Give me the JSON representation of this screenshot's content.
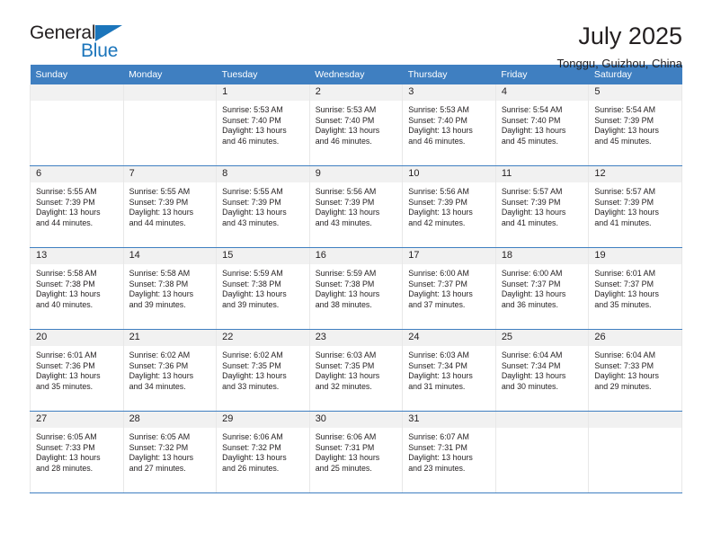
{
  "brand": {
    "name_part1": "General",
    "name_part2": "Blue",
    "triangle_icon": "blue-triangle-icon",
    "colors": {
      "dark": "#231f20",
      "blue": "#1b75bb"
    }
  },
  "header": {
    "title": "July 2025",
    "subtitle": "Tonggu, Guizhou, China"
  },
  "theme": {
    "header_row_bg": "#3f7fc1",
    "day_number_bg": "#f1f1f1",
    "cell_bg": "#ffffff",
    "separator": "#3f7fc1",
    "text": "#231f20"
  },
  "weekday_headers": [
    "Sunday",
    "Monday",
    "Tuesday",
    "Wednesday",
    "Thursday",
    "Friday",
    "Saturday"
  ],
  "weeks": [
    [
      {
        "day": "",
        "empty": true,
        "sunrise": "",
        "sunset": "",
        "daylight_line1": "",
        "daylight_line2": ""
      },
      {
        "day": "",
        "empty": true,
        "sunrise": "",
        "sunset": "",
        "daylight_line1": "",
        "daylight_line2": ""
      },
      {
        "day": "1",
        "empty": false,
        "sunrise": "Sunrise: 5:53 AM",
        "sunset": "Sunset: 7:40 PM",
        "daylight_line1": "Daylight: 13 hours",
        "daylight_line2": "and 46 minutes."
      },
      {
        "day": "2",
        "empty": false,
        "sunrise": "Sunrise: 5:53 AM",
        "sunset": "Sunset: 7:40 PM",
        "daylight_line1": "Daylight: 13 hours",
        "daylight_line2": "and 46 minutes."
      },
      {
        "day": "3",
        "empty": false,
        "sunrise": "Sunrise: 5:53 AM",
        "sunset": "Sunset: 7:40 PM",
        "daylight_line1": "Daylight: 13 hours",
        "daylight_line2": "and 46 minutes."
      },
      {
        "day": "4",
        "empty": false,
        "sunrise": "Sunrise: 5:54 AM",
        "sunset": "Sunset: 7:40 PM",
        "daylight_line1": "Daylight: 13 hours",
        "daylight_line2": "and 45 minutes."
      },
      {
        "day": "5",
        "empty": false,
        "sunrise": "Sunrise: 5:54 AM",
        "sunset": "Sunset: 7:39 PM",
        "daylight_line1": "Daylight: 13 hours",
        "daylight_line2": "and 45 minutes."
      }
    ],
    [
      {
        "day": "6",
        "empty": false,
        "sunrise": "Sunrise: 5:55 AM",
        "sunset": "Sunset: 7:39 PM",
        "daylight_line1": "Daylight: 13 hours",
        "daylight_line2": "and 44 minutes."
      },
      {
        "day": "7",
        "empty": false,
        "sunrise": "Sunrise: 5:55 AM",
        "sunset": "Sunset: 7:39 PM",
        "daylight_line1": "Daylight: 13 hours",
        "daylight_line2": "and 44 minutes."
      },
      {
        "day": "8",
        "empty": false,
        "sunrise": "Sunrise: 5:55 AM",
        "sunset": "Sunset: 7:39 PM",
        "daylight_line1": "Daylight: 13 hours",
        "daylight_line2": "and 43 minutes."
      },
      {
        "day": "9",
        "empty": false,
        "sunrise": "Sunrise: 5:56 AM",
        "sunset": "Sunset: 7:39 PM",
        "daylight_line1": "Daylight: 13 hours",
        "daylight_line2": "and 43 minutes."
      },
      {
        "day": "10",
        "empty": false,
        "sunrise": "Sunrise: 5:56 AM",
        "sunset": "Sunset: 7:39 PM",
        "daylight_line1": "Daylight: 13 hours",
        "daylight_line2": "and 42 minutes."
      },
      {
        "day": "11",
        "empty": false,
        "sunrise": "Sunrise: 5:57 AM",
        "sunset": "Sunset: 7:39 PM",
        "daylight_line1": "Daylight: 13 hours",
        "daylight_line2": "and 41 minutes."
      },
      {
        "day": "12",
        "empty": false,
        "sunrise": "Sunrise: 5:57 AM",
        "sunset": "Sunset: 7:39 PM",
        "daylight_line1": "Daylight: 13 hours",
        "daylight_line2": "and 41 minutes."
      }
    ],
    [
      {
        "day": "13",
        "empty": false,
        "sunrise": "Sunrise: 5:58 AM",
        "sunset": "Sunset: 7:38 PM",
        "daylight_line1": "Daylight: 13 hours",
        "daylight_line2": "and 40 minutes."
      },
      {
        "day": "14",
        "empty": false,
        "sunrise": "Sunrise: 5:58 AM",
        "sunset": "Sunset: 7:38 PM",
        "daylight_line1": "Daylight: 13 hours",
        "daylight_line2": "and 39 minutes."
      },
      {
        "day": "15",
        "empty": false,
        "sunrise": "Sunrise: 5:59 AM",
        "sunset": "Sunset: 7:38 PM",
        "daylight_line1": "Daylight: 13 hours",
        "daylight_line2": "and 39 minutes."
      },
      {
        "day": "16",
        "empty": false,
        "sunrise": "Sunrise: 5:59 AM",
        "sunset": "Sunset: 7:38 PM",
        "daylight_line1": "Daylight: 13 hours",
        "daylight_line2": "and 38 minutes."
      },
      {
        "day": "17",
        "empty": false,
        "sunrise": "Sunrise: 6:00 AM",
        "sunset": "Sunset: 7:37 PM",
        "daylight_line1": "Daylight: 13 hours",
        "daylight_line2": "and 37 minutes."
      },
      {
        "day": "18",
        "empty": false,
        "sunrise": "Sunrise: 6:00 AM",
        "sunset": "Sunset: 7:37 PM",
        "daylight_line1": "Daylight: 13 hours",
        "daylight_line2": "and 36 minutes."
      },
      {
        "day": "19",
        "empty": false,
        "sunrise": "Sunrise: 6:01 AM",
        "sunset": "Sunset: 7:37 PM",
        "daylight_line1": "Daylight: 13 hours",
        "daylight_line2": "and 35 minutes."
      }
    ],
    [
      {
        "day": "20",
        "empty": false,
        "sunrise": "Sunrise: 6:01 AM",
        "sunset": "Sunset: 7:36 PM",
        "daylight_line1": "Daylight: 13 hours",
        "daylight_line2": "and 35 minutes."
      },
      {
        "day": "21",
        "empty": false,
        "sunrise": "Sunrise: 6:02 AM",
        "sunset": "Sunset: 7:36 PM",
        "daylight_line1": "Daylight: 13 hours",
        "daylight_line2": "and 34 minutes."
      },
      {
        "day": "22",
        "empty": false,
        "sunrise": "Sunrise: 6:02 AM",
        "sunset": "Sunset: 7:35 PM",
        "daylight_line1": "Daylight: 13 hours",
        "daylight_line2": "and 33 minutes."
      },
      {
        "day": "23",
        "empty": false,
        "sunrise": "Sunrise: 6:03 AM",
        "sunset": "Sunset: 7:35 PM",
        "daylight_line1": "Daylight: 13 hours",
        "daylight_line2": "and 32 minutes."
      },
      {
        "day": "24",
        "empty": false,
        "sunrise": "Sunrise: 6:03 AM",
        "sunset": "Sunset: 7:34 PM",
        "daylight_line1": "Daylight: 13 hours",
        "daylight_line2": "and 31 minutes."
      },
      {
        "day": "25",
        "empty": false,
        "sunrise": "Sunrise: 6:04 AM",
        "sunset": "Sunset: 7:34 PM",
        "daylight_line1": "Daylight: 13 hours",
        "daylight_line2": "and 30 minutes."
      },
      {
        "day": "26",
        "empty": false,
        "sunrise": "Sunrise: 6:04 AM",
        "sunset": "Sunset: 7:33 PM",
        "daylight_line1": "Daylight: 13 hours",
        "daylight_line2": "and 29 minutes."
      }
    ],
    [
      {
        "day": "27",
        "empty": false,
        "sunrise": "Sunrise: 6:05 AM",
        "sunset": "Sunset: 7:33 PM",
        "daylight_line1": "Daylight: 13 hours",
        "daylight_line2": "and 28 minutes."
      },
      {
        "day": "28",
        "empty": false,
        "sunrise": "Sunrise: 6:05 AM",
        "sunset": "Sunset: 7:32 PM",
        "daylight_line1": "Daylight: 13 hours",
        "daylight_line2": "and 27 minutes."
      },
      {
        "day": "29",
        "empty": false,
        "sunrise": "Sunrise: 6:06 AM",
        "sunset": "Sunset: 7:32 PM",
        "daylight_line1": "Daylight: 13 hours",
        "daylight_line2": "and 26 minutes."
      },
      {
        "day": "30",
        "empty": false,
        "sunrise": "Sunrise: 6:06 AM",
        "sunset": "Sunset: 7:31 PM",
        "daylight_line1": "Daylight: 13 hours",
        "daylight_line2": "and 25 minutes."
      },
      {
        "day": "31",
        "empty": false,
        "sunrise": "Sunrise: 6:07 AM",
        "sunset": "Sunset: 7:31 PM",
        "daylight_line1": "Daylight: 13 hours",
        "daylight_line2": "and 23 minutes."
      },
      {
        "day": "",
        "empty": true,
        "sunrise": "",
        "sunset": "",
        "daylight_line1": "",
        "daylight_line2": ""
      },
      {
        "day": "",
        "empty": true,
        "sunrise": "",
        "sunset": "",
        "daylight_line1": "",
        "daylight_line2": ""
      }
    ]
  ]
}
